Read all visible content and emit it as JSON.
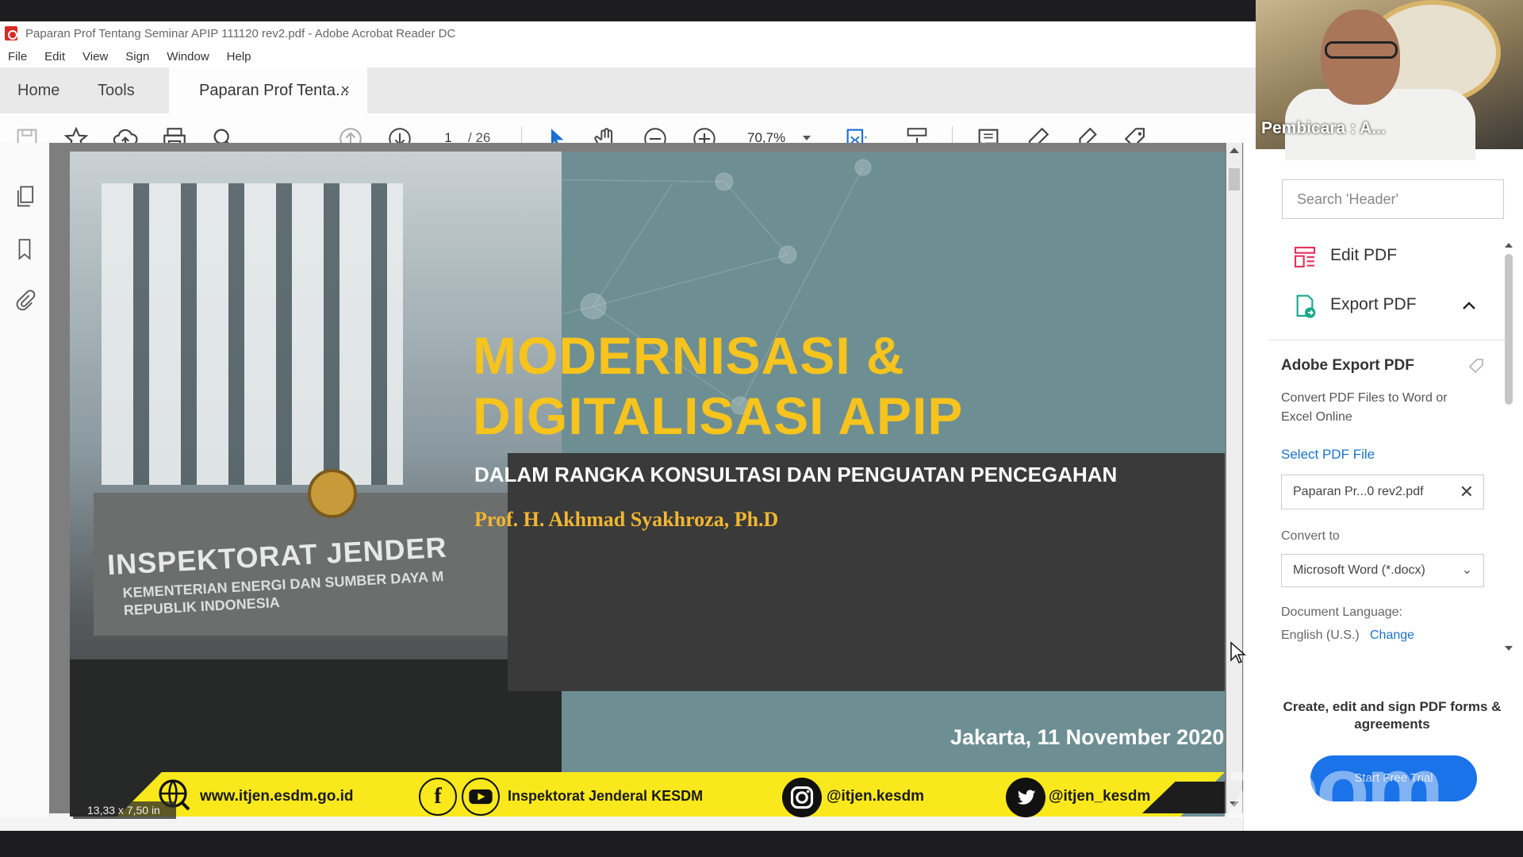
{
  "window": {
    "title": "Paparan Prof Tentang Seminar APIP 111120 rev2.pdf - Adobe Acrobat Reader DC",
    "menu": [
      "File",
      "Edit",
      "View",
      "Sign",
      "Window",
      "Help"
    ]
  },
  "tabs": {
    "home": "Home",
    "tools": "Tools",
    "document": "Paparan Prof Tenta...",
    "close": "×"
  },
  "toolbar": {
    "page_current": "1",
    "page_total": "/ 26",
    "zoom": "70,7%"
  },
  "slide": {
    "title_line1": "MODERNISASI &",
    "title_line2": "DIGITALISASI APIP",
    "subtitle": "DALAM RANGKA KONSULTASI DAN PENGUATAN PENCEGAHAN",
    "speaker": "Prof. H. Akhmad Syakhroza, Ph.D",
    "date": "Jakarta,  11 November 2020",
    "building_sign": "INSPEKTORAT JENDER",
    "building_sub": "KEMENTERIAN ENERGI DAN SUMBER DAYA M REPUBLIK INDONESIA",
    "footer": {
      "website": "www.itjen.esdm.go.id",
      "social_name": "Inspektorat Jenderal KESDM",
      "instagram": "@itjen.kesdm",
      "twitter": "@itjen_kesdm"
    },
    "page_size": "13,33 x 7,50 in"
  },
  "right_panel": {
    "search_placeholder": "Search 'Header'",
    "edit_pdf": "Edit PDF",
    "export_pdf": "Export PDF",
    "heading": "Adobe Export PDF",
    "description": "Convert PDF Files to Word or Excel Online",
    "select_file": "Select PDF File",
    "file_name": "Paparan Pr...0 rev2.pdf",
    "convert_label": "Convert to",
    "convert_value": "Microsoft Word (*.docx)",
    "language_label": "Document Language:",
    "language_value": "English (U.S.)",
    "change_link": "Change",
    "promo": "Create, edit and sign PDF forms & agreements",
    "trial_button": "Start Free Trial"
  },
  "webcam": {
    "speaker_label": "Pembicara : A..."
  },
  "watermark": "zoom",
  "colors": {
    "accent_yellow": "#f7c31d",
    "link_blue": "#1a73c9",
    "acrobat_red": "#d92b25"
  }
}
